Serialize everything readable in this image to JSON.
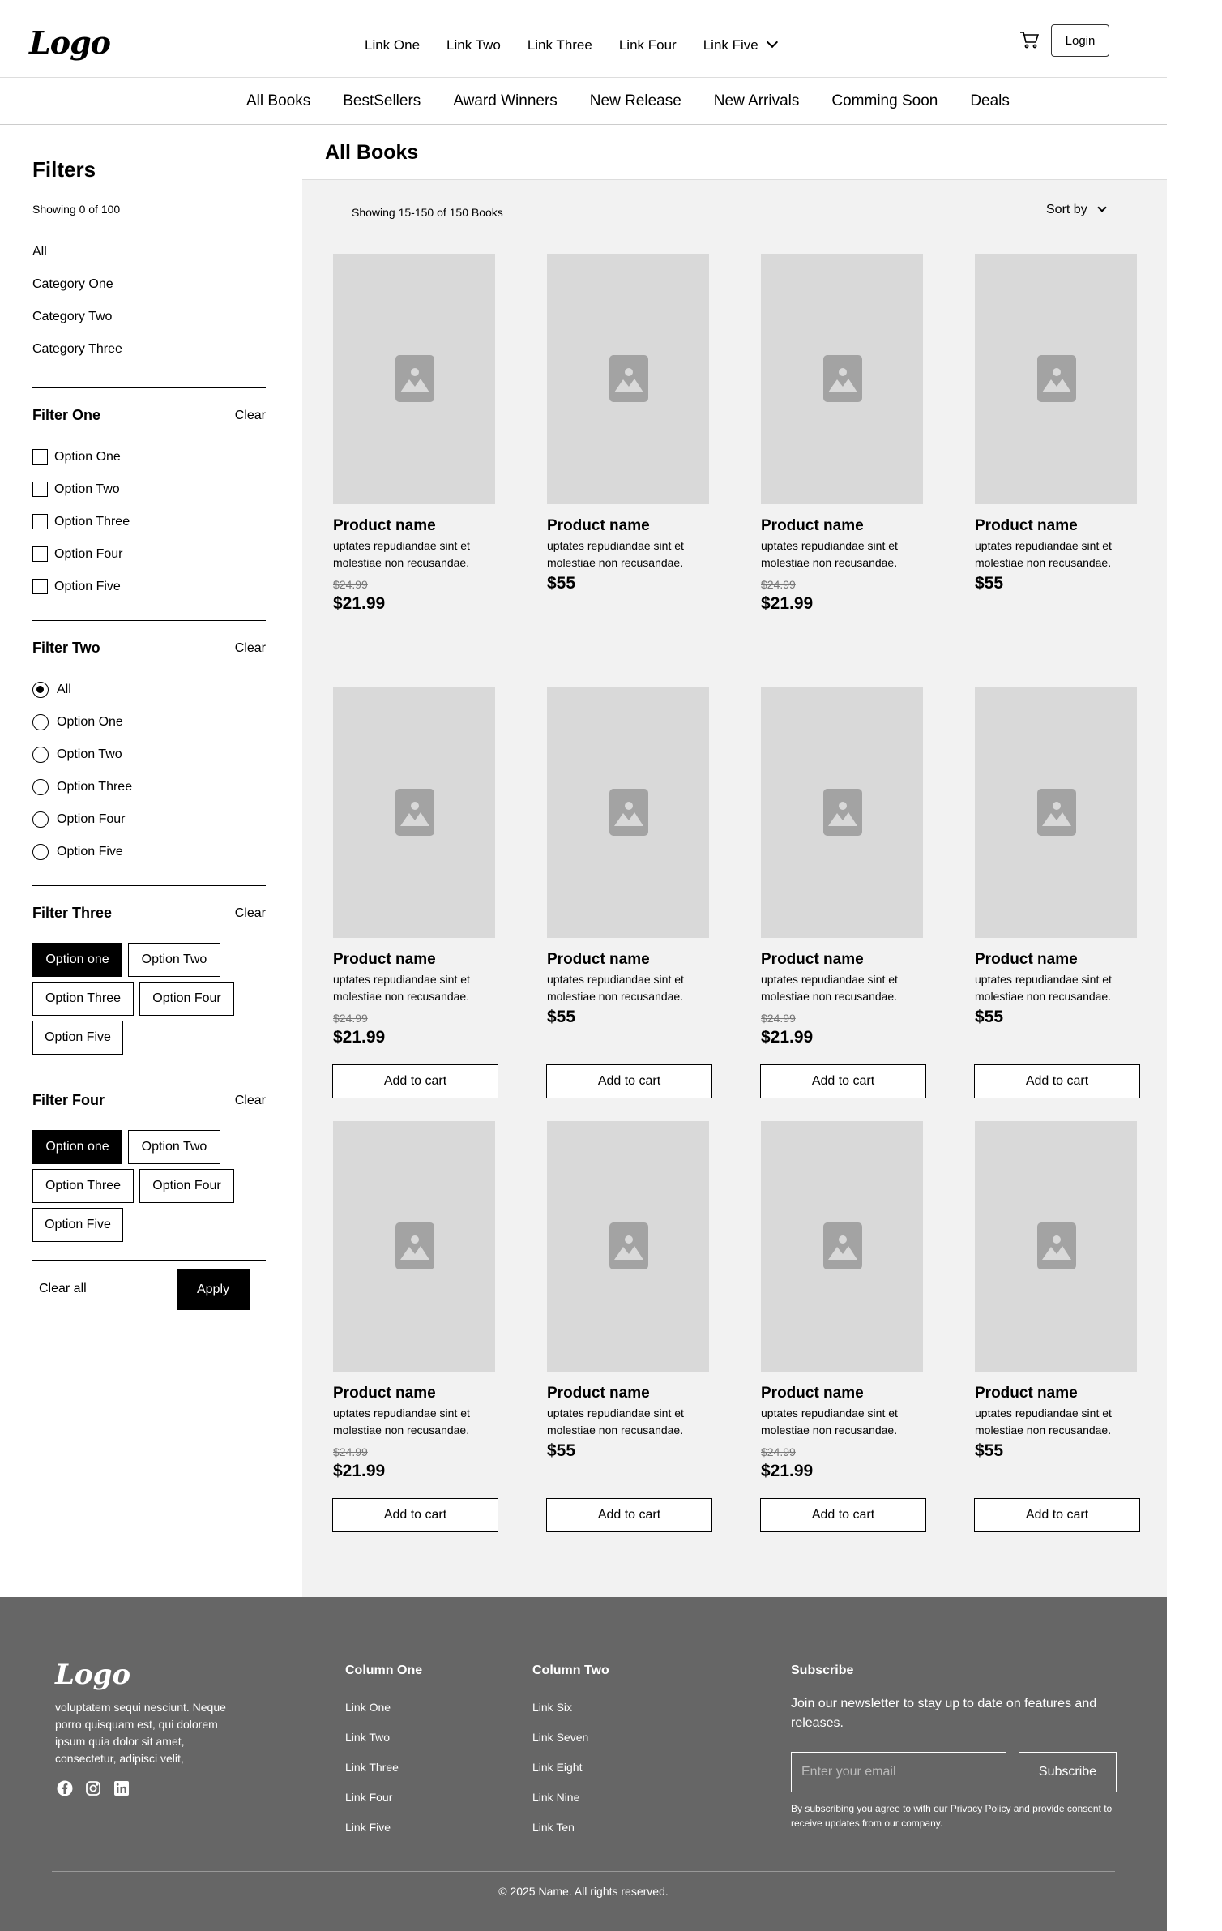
{
  "header": {
    "logo": "Logo",
    "nav": [
      "Link One",
      "Link Two",
      "Link Three",
      "Link Four",
      "Link Five"
    ],
    "login": "Login",
    "icons": [
      "cart-icon",
      "chevron-down-icon"
    ]
  },
  "categories": [
    "All Books",
    "BestSellers",
    "Award Winners",
    "New Release",
    "New Arrivals",
    "Comming Soon",
    "Deals"
  ],
  "sidebar": {
    "title": "Filters",
    "showing": "Showing 0 of 100",
    "cats": [
      "All",
      "Category One",
      "Category Two",
      "Category Three"
    ],
    "filter_one": {
      "title": "Filter One",
      "clear": "Clear",
      "options": [
        "Option One",
        "Option Two",
        "Option Three",
        "Option Four",
        "Option Five"
      ]
    },
    "filter_two": {
      "title": "Filter Two",
      "clear": "Clear",
      "options": [
        "All",
        "Option One",
        "Option Two",
        "Option Three",
        "Option Four",
        "Option Five"
      ],
      "selected": "All"
    },
    "filter_three": {
      "title": "Filter Three",
      "clear": "Clear",
      "chips": [
        "Option one",
        "Option Two",
        "Option Three",
        "Option Four",
        "Option Five"
      ],
      "selected": "Option one"
    },
    "filter_four": {
      "title": "Filter Four",
      "clear": "Clear",
      "chips": [
        "Option one",
        "Option Two",
        "Option Three",
        "Option Four",
        "Option Five"
      ],
      "selected": "Option one"
    },
    "clear_all": "Clear all",
    "apply": "Apply"
  },
  "main": {
    "title": "All Books",
    "showing": "Showing 15-150 of 150 Books",
    "sort": "Sort by",
    "product": {
      "name": "Product name",
      "desc": "uptates repudiandae sint et molestiae non recusandae.",
      "old_price": "$24.99",
      "sale_price": "$21.99",
      "price": "$55",
      "add_to_cart": "Add to cart"
    }
  },
  "footer": {
    "logo": "Logo",
    "about": "voluptatem sequi nesciunt. Neque porro quisquam est, qui dolorem ipsum quia dolor sit amet, consectetur, adipisci velit,",
    "social_icons": [
      "facebook-icon",
      "instagram-icon",
      "linkedin-icon"
    ],
    "col_one": {
      "title": "Column One",
      "links": [
        "Link One",
        "Link Two",
        "Link Three",
        "Link Four",
        "Link Five"
      ]
    },
    "col_two": {
      "title": "Column Two",
      "links": [
        "Link Six",
        "Link Seven",
        "Link Eight",
        "Link Nine",
        "Link Ten"
      ]
    },
    "subscribe": {
      "title": "Subscribe",
      "text": "Join our newsletter to stay up to date on features and releases.",
      "placeholder": "Enter your email",
      "button": "Subscribe",
      "fine_a": "By subscribing you agree to with our ",
      "fine_link": "Privacy Policy",
      "fine_b": " and provide consent to receive updates from our company."
    },
    "copyright": "© 2025 Name. All rights reserved."
  }
}
